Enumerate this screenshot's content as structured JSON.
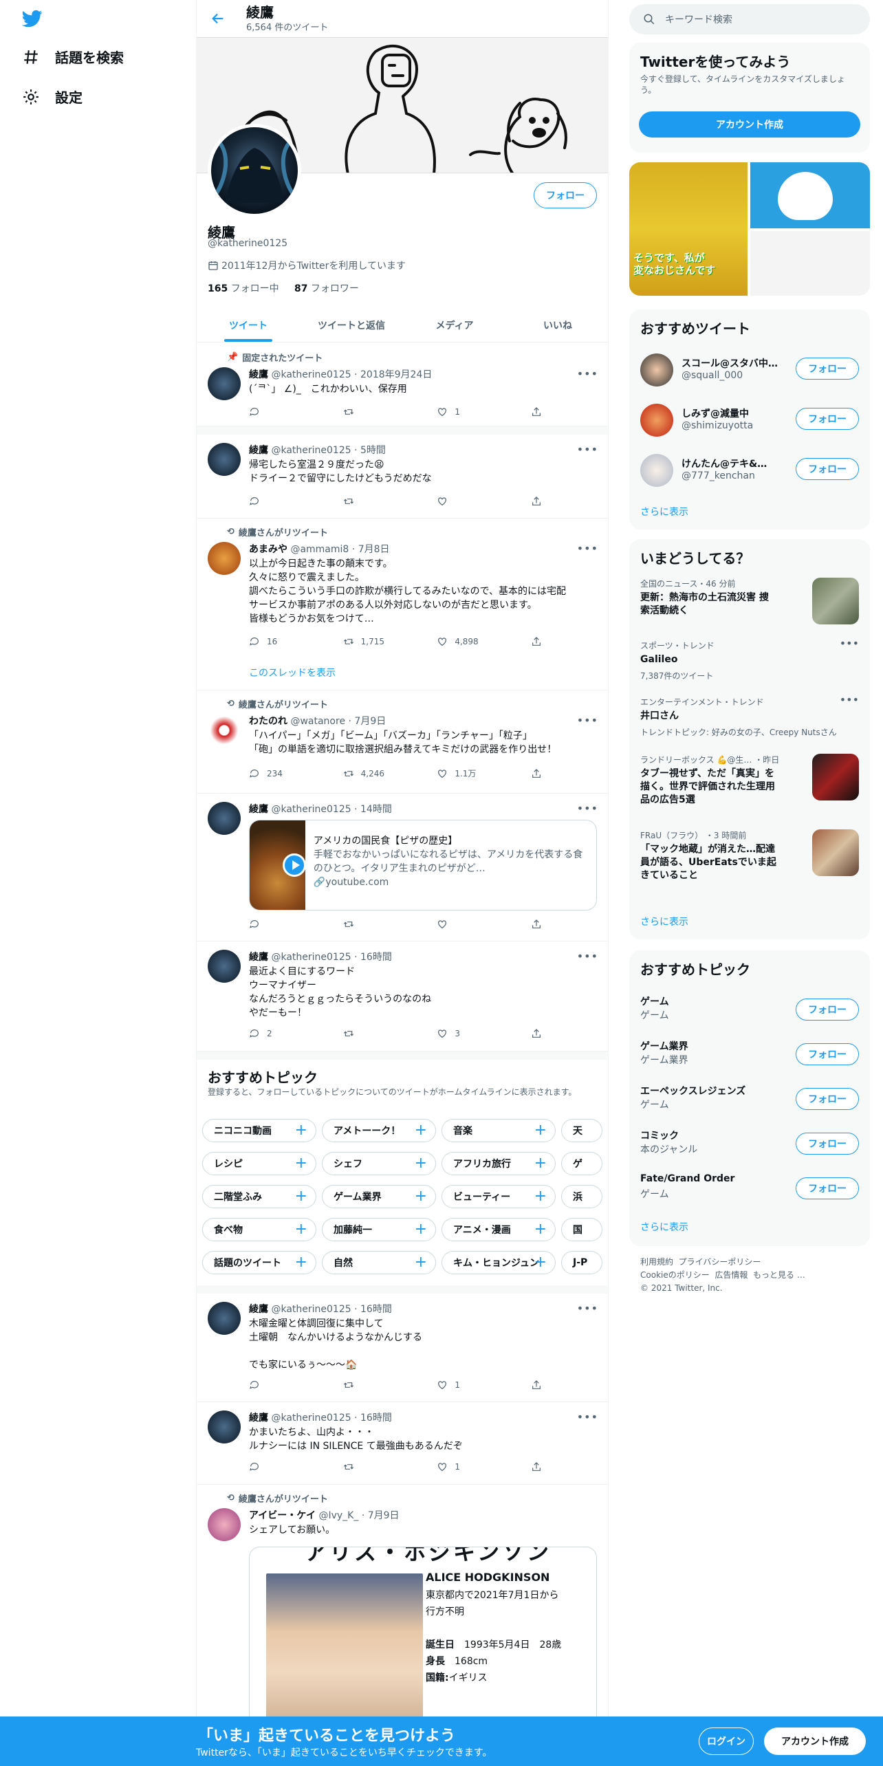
{
  "nav": {
    "explore": "話題を検索",
    "settings": "設定"
  },
  "header": {
    "title": "綾鷹",
    "count": "6,564 件のツイート"
  },
  "profile": {
    "name": "綾鷹",
    "handle": "@katherine0125",
    "joined": "2011年12月からTwitterを利用しています",
    "following_num": "165",
    "following_label": "フォロー中",
    "followers_num": "87",
    "followers_label": "フォロワー",
    "follow": "フォロー"
  },
  "tabs": [
    "ツイート",
    "ツイートと返信",
    "メディア",
    "いいね"
  ],
  "tweets": [
    {
      "context": "固定されたツイート",
      "name": "綾鷹",
      "handle": "@katherine0125",
      "time": "2018年9月24日",
      "text": "(´ᄏ`」 ∠)_　これかわいい、保存用",
      "reply": "",
      "rt": "",
      "like": "1"
    },
    {
      "context": "",
      "name": "綾鷹",
      "handle": "@katherine0125",
      "time": "5時間",
      "text": "帰宅したら室温２９度だった😫\nドライー２で留守にしたけどもうだめだな",
      "reply": "",
      "rt": "",
      "like": ""
    },
    {
      "context": "綾鷹さんがリツイート",
      "name": "あまみや",
      "handle": "@ammami8",
      "time": "7月8日",
      "text": "以上が今日起きた事の顛末です。\n久々に怒りで震えました。\n調べたらこういう手口の詐欺が横行してるみたいなので、基本的には宅配\nサービスか事前アポのある人以外対応しないのが吉だと思います。\n皆様もどうかお気をつけて…",
      "reply": "16",
      "rt": "1,715",
      "like": "4,898",
      "showthread": "このスレッドを表示"
    },
    {
      "context": "綾鷹さんがリツイート",
      "name": "わたのれ",
      "handle": "@watanore",
      "time": "7月9日",
      "text": "「ハイパー」「メガ」「ビーム」「バズーカ」「ランチャー」「粒子」\n「砲」の単語を適切に取捨選択組み替えてキミだけの武器を作り出せ！",
      "reply": "234",
      "rt": "4,246",
      "like": "1.1万"
    },
    {
      "context": "",
      "name": "綾鷹",
      "handle": "@katherine0125",
      "time": "14時間",
      "text": "",
      "reply": "",
      "rt": "",
      "like": "",
      "card": {
        "title": "アメリカの国民食【ピザの歴史】",
        "desc": "手軽でおなかいっぱいになれるピザは、アメリカを代表する食のひとつ。イタリア生まれのピザがど…",
        "domain": "youtube.com"
      }
    },
    {
      "context": "",
      "name": "綾鷹",
      "handle": "@katherine0125",
      "time": "16時間",
      "text": "最近よく目にするワード\nウーマナイザー\nなんだろうとｇｇったらそういうのなのね\nやだーもー！",
      "reply": "2",
      "rt": "",
      "like": "3"
    },
    {
      "context": "",
      "name": "綾鷹",
      "handle": "@katherine0125",
      "time": "16時間",
      "text": "木曜金曜と体調回復に集中して\n土曜朝　なんかいけるようなかんじする\n\nでも家にいるぅ～～～🏠",
      "reply": "",
      "rt": "",
      "like": "1"
    },
    {
      "context": "",
      "name": "綾鷹",
      "handle": "@katherine0125",
      "time": "16時間",
      "text": "かまいたちよ、山内よ・・・\nルナシーには IN SILENCE て最強曲もあるんだぞ",
      "reply": "",
      "rt": "",
      "like": "1"
    },
    {
      "context": "綾鷹さんがリツイート",
      "name": "アイビー・ケイ",
      "handle": "@Ivy_K_",
      "time": "7月9日",
      "text": "シェアしてお願い。",
      "reply": "",
      "rt": "",
      "like": ""
    }
  ],
  "missing": {
    "top": "アリス・ホジキンソン",
    "name": "ALICE HODGKINSON",
    "l1": "東京都内で2021年7月1日から",
    "l2": "行方不明",
    "born_label": "誕生日",
    "born": "1993年5月4日　28歳",
    "height_label": "身長",
    "height": "168cm",
    "nation_label": "国籍:",
    "nation": "イギリス"
  },
  "topics_section": {
    "title": "おすすめトピック",
    "sub": "登録すると、フォローしているトピックについてのツイートがホームタイムラインに表示されます。",
    "rows": [
      [
        "ニコニコ動画",
        "アメトーーク！",
        "音楽",
        "天"
      ],
      [
        "レシピ",
        "シェフ",
        "アフリカ旅行",
        "ゲ"
      ],
      [
        "二階堂ふみ",
        "ゲーム業界",
        "ビューティー",
        "浜"
      ],
      [
        "食べ物",
        "加藤純一",
        "アニメ・漫画",
        "国"
      ],
      [
        "話題のツイート",
        "自然",
        "キム・ヒョンジュン",
        "J-P"
      ]
    ]
  },
  "right": {
    "search_placeholder": "キーワード検索",
    "signup": {
      "title": "Twitterを使ってみよう",
      "desc": "今すぐ登録して、タイムラインをカスタマイズしましょう。",
      "btn": "アカウント作成"
    },
    "media_text": "そうです、私が\n変なおじさんです",
    "recs_title": "おすすめツイート",
    "recs": [
      {
        "name": "スコール@スタバ中…",
        "handle": "@squall_000"
      },
      {
        "name": "しみず@減量中",
        "handle": "@shimizuyotta"
      },
      {
        "name": "けんたん@テキ&…",
        "handle": "@777_kenchan"
      }
    ],
    "follow": "フォロー",
    "more": "さらに表示",
    "trends_title": "いまどうしてる？",
    "trends": [
      {
        "cat": "全国のニュース・46 分前",
        "title": "更新：熱海市の土石流災害 捜索活動続く",
        "sub": ""
      },
      {
        "cat": "スポーツ・トレンド",
        "title": "Galileo",
        "sub": "7,387件のツイート"
      },
      {
        "cat": "エンターテインメント・トレンド",
        "title": "井口さん",
        "sub": "トレンドトピック: 好みの女の子、Creepy Nutsさん"
      },
      {
        "cat": "ランドリーボックス 💪@生… ・昨日",
        "title": "タブー視せず、ただ「真実」を描く。世界で評価された生理用品の広告5選",
        "sub": ""
      },
      {
        "cat": "FRaU（フラウ） ・3 時間前",
        "title": "「マック地蔵」が消えた…配達員が語る、UberEatsでいま起きていること",
        "sub": ""
      }
    ],
    "topics_title": "おすすめトピック",
    "topics": [
      {
        "name": "ゲーム",
        "cat": "ゲーム"
      },
      {
        "name": "ゲーム業界",
        "cat": "ゲーム業界"
      },
      {
        "name": "エーペックスレジェンズ",
        "cat": "ゲーム"
      },
      {
        "name": "コミック",
        "cat": "本のジャンル"
      },
      {
        "name": "Fate/Grand Order",
        "cat": "ゲーム"
      }
    ],
    "footer": [
      "利用規約",
      "プライバシーポリシー",
      "Cookieのポリシー",
      "広告情報",
      "もっと見る …",
      "© 2021 Twitter, Inc."
    ]
  },
  "bottom": {
    "title": "「いま」起きていることを見つけよう",
    "sub": "Twitterなら、「いま」起きていることをいち早くチェックできます。",
    "login": "ログイン",
    "signup": "アカウント作成"
  },
  "colors": {
    "accent": "#1d9bf0",
    "text": "#0f1419",
    "muted": "#536471"
  }
}
